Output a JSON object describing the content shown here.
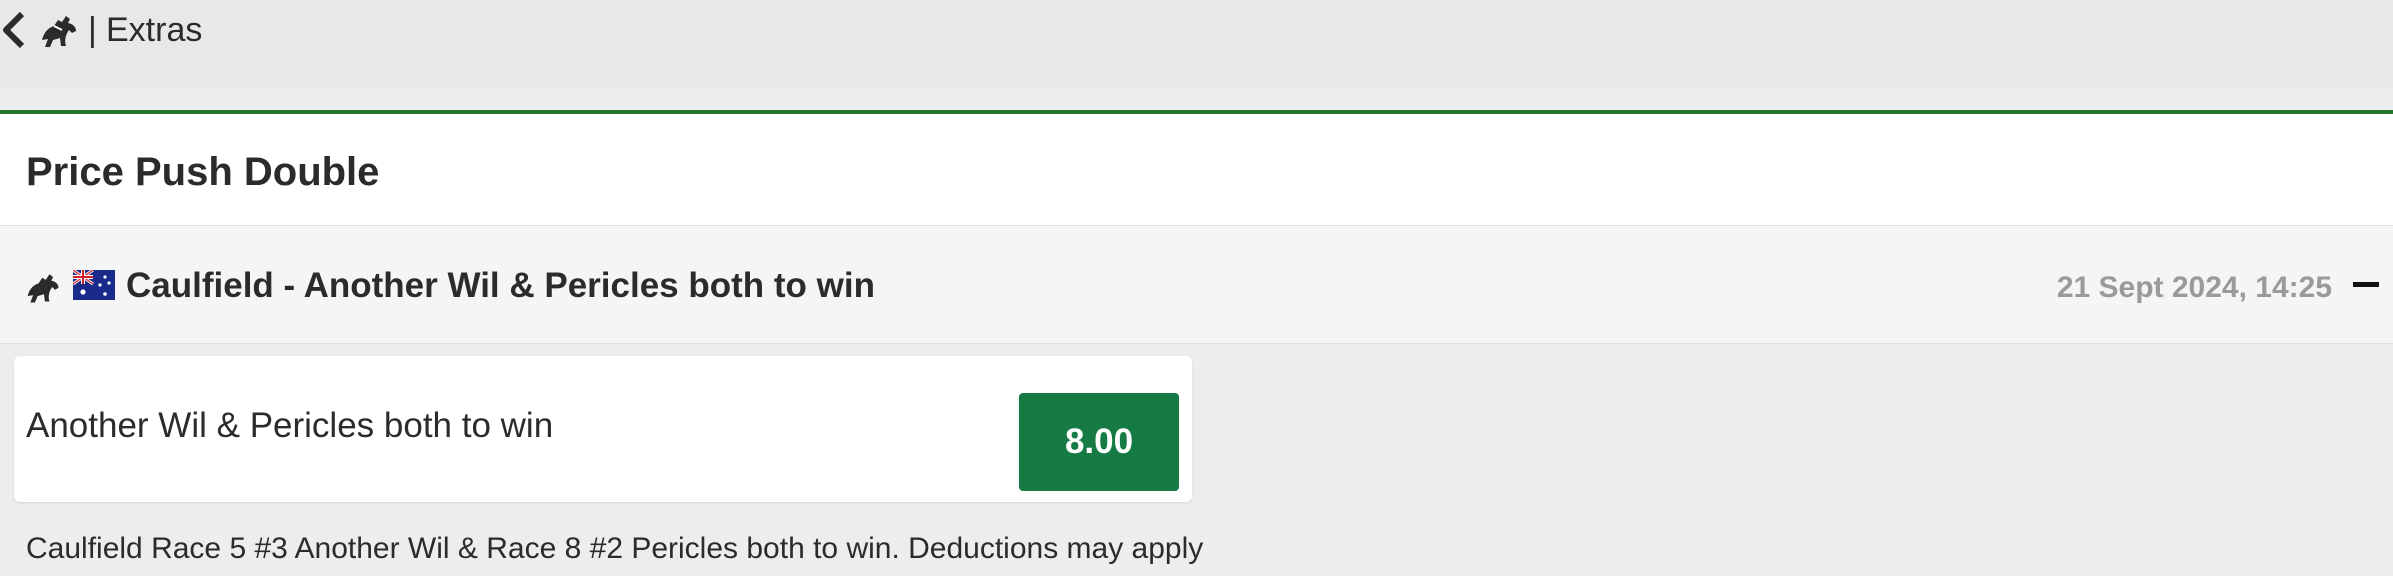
{
  "breadcrumb": {
    "separator": "|",
    "label": "Extras",
    "back_icon": "chevron-left-icon",
    "sport_icon": "horse-racing-icon"
  },
  "card": {
    "title": "Price Push Double",
    "accent_color": "#22762b"
  },
  "event": {
    "title": "Caulfield - Another Wil & Pericles both to win",
    "datetime": "21 Sept 2024, 14:25",
    "sport_icon": "horse-racing-icon",
    "flag_icon": "australia-flag-icon",
    "toggle_icon": "minus-icon"
  },
  "market": {
    "selection_label": "Another Wil & Pericles both to win",
    "price": "8.00",
    "price_color": "#167a44",
    "description": "Caulfield Race 5 #3 Another Wil & Race 8 #2 Pericles both to win. Deductions may apply"
  }
}
